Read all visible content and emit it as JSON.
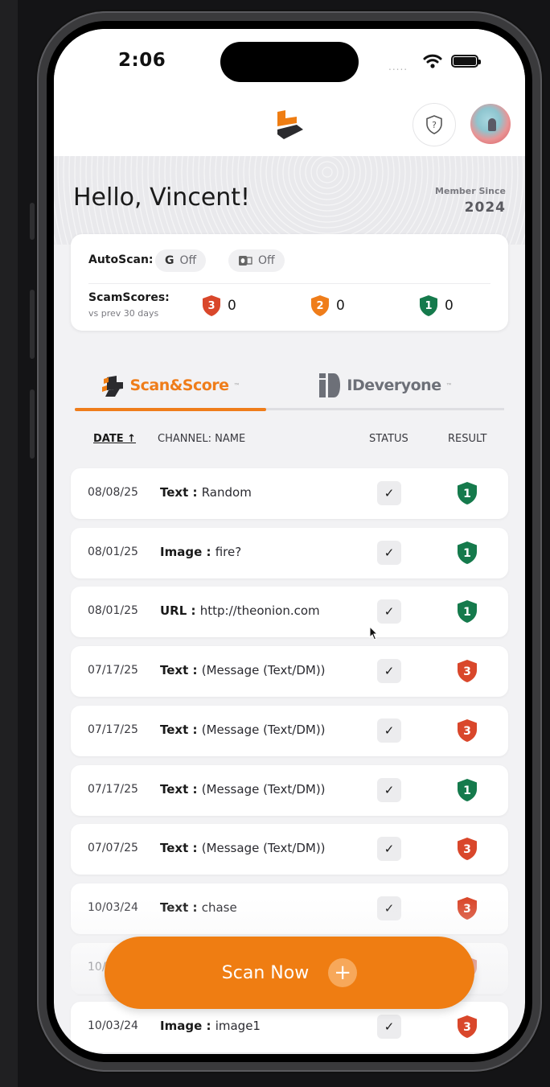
{
  "status_bar": {
    "time": "2:06",
    "signal": "....."
  },
  "colors": {
    "brand_orange": "#ef7d12",
    "shield_green": "#157a4c",
    "shield_red": "#d9472b",
    "shield_orange": "#ef7d1a"
  },
  "header": {
    "logo_icon": "brand-logo-icon",
    "help_icon": "shield-question-icon",
    "avatar_icon": "user-avatar"
  },
  "greeting": {
    "text": "Hello, Vincent!",
    "member_since_label": "Member Since",
    "member_since_year": "2024"
  },
  "autoscan": {
    "label": "AutoScan:",
    "gmail": {
      "icon": "G",
      "state": "Off"
    },
    "outlook": {
      "icon": "outlook-icon",
      "state": "Off"
    }
  },
  "scamscores": {
    "label": "ScamScores:",
    "sublabel": "vs prev 30 days",
    "items": [
      {
        "level": "3",
        "count": "0",
        "color": "red"
      },
      {
        "level": "2",
        "count": "0",
        "color": "orange"
      },
      {
        "level": "1",
        "count": "0",
        "color": "green"
      }
    ]
  },
  "tabs": [
    {
      "label": "Scan&Score",
      "tm": "™",
      "active": true
    },
    {
      "label": "IDeveryone",
      "tm": "™",
      "active": false
    }
  ],
  "table": {
    "headers": {
      "date": "DATE ↑",
      "channel": "CHANNEL: NAME",
      "status": "STATUS",
      "result": "RESULT"
    },
    "rows": [
      {
        "date": "08/08/25",
        "type": "Text",
        "name": "Random",
        "status": "✓",
        "result": "1"
      },
      {
        "date": "08/01/25",
        "type": "Image",
        "name": "fire?",
        "status": "✓",
        "result": "1"
      },
      {
        "date": "08/01/25",
        "type": "URL",
        "name": "http://theonion.com",
        "status": "✓",
        "result": "1"
      },
      {
        "date": "07/17/25",
        "type": "Text",
        "name": "(Message (Text/DM))",
        "status": "✓",
        "result": "3"
      },
      {
        "date": "07/17/25",
        "type": "Text",
        "name": "(Message (Text/DM))",
        "status": "✓",
        "result": "3"
      },
      {
        "date": "07/17/25",
        "type": "Text",
        "name": "(Message (Text/DM))",
        "status": "✓",
        "result": "1"
      },
      {
        "date": "07/07/25",
        "type": "Text",
        "name": "(Message (Text/DM))",
        "status": "✓",
        "result": "3"
      },
      {
        "date": "10/03/24",
        "type": "Text",
        "name": "chase",
        "status": "✓",
        "result": "3"
      },
      {
        "date": "10/",
        "type": "",
        "name": "",
        "status": "",
        "result": "3"
      },
      {
        "date": "10/03/24",
        "type": "Image",
        "name": "image1",
        "status": "✓",
        "result": "3"
      }
    ]
  },
  "scan_button": {
    "label": "Scan Now",
    "icon": "+"
  }
}
